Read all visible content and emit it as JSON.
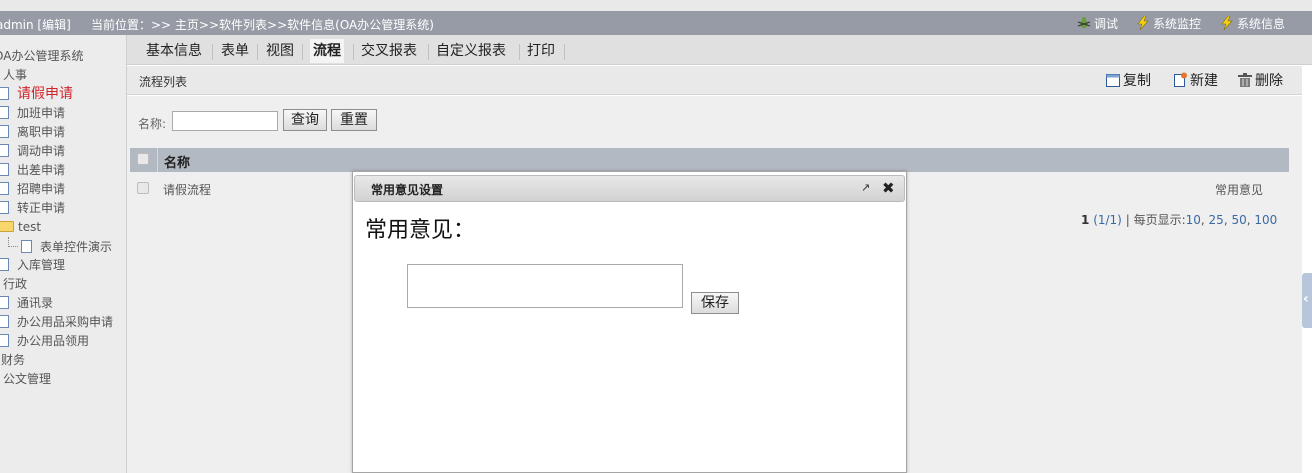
{
  "topbar": {
    "user": "admin [编辑]",
    "location": "当前位置：>> 主页>>软件列表>>软件信息(OA办公管理系统)",
    "tools": [
      "调试",
      "系统监控",
      "系统信息"
    ]
  },
  "sidebar": {
    "root": "OA办公管理系统",
    "items": [
      {
        "label": "人事",
        "type": "group"
      },
      {
        "label": "请假申请",
        "type": "doc",
        "active": true
      },
      {
        "label": "加班申请",
        "type": "doc"
      },
      {
        "label": "离职申请",
        "type": "doc"
      },
      {
        "label": "调动申请",
        "type": "doc"
      },
      {
        "label": "出差申请",
        "type": "doc"
      },
      {
        "label": "招聘申请",
        "type": "doc"
      },
      {
        "label": "转正申请",
        "type": "doc"
      },
      {
        "label": "test",
        "type": "folder"
      },
      {
        "label": "表单控件演示",
        "type": "child-doc"
      },
      {
        "label": "入库管理",
        "type": "doc"
      },
      {
        "label": "行政",
        "type": "group"
      },
      {
        "label": "通讯录",
        "type": "doc"
      },
      {
        "label": "办公用品采购申请",
        "type": "doc"
      },
      {
        "label": "办公用品领用",
        "type": "doc"
      },
      {
        "label": "财务",
        "type": "group"
      },
      {
        "label": "公文管理",
        "type": "group"
      }
    ]
  },
  "tabs": [
    "基本信息",
    "表单",
    "视图",
    "流程",
    "交叉报表",
    "自定义报表",
    "打印"
  ],
  "active_tab": "流程",
  "subbar": {
    "title": "流程列表",
    "actions": [
      "复制",
      "新建",
      "删除"
    ]
  },
  "search": {
    "label": "名称:",
    "value": "",
    "query_button": "查询",
    "reset_button": "重置"
  },
  "table": {
    "header": "名称",
    "rows": [
      {
        "name": "请假流程",
        "action": "常用意见"
      }
    ]
  },
  "pager": {
    "page": "1",
    "total": "(1/1)",
    "sep": "|",
    "per_page_label": "每页显示:",
    "options": [
      "10",
      "25",
      "50",
      "100"
    ]
  },
  "dialog": {
    "title": "常用意见设置",
    "label": "常用意见：",
    "textarea_value": "",
    "save_button": "保存"
  },
  "colors": {
    "topbar": "#969ba5",
    "active_item": "#d0262b",
    "table_header": "#b3b9c2"
  }
}
